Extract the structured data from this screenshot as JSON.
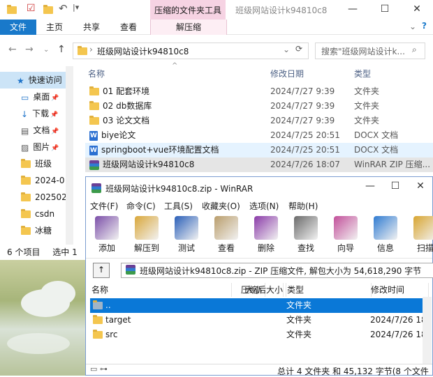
{
  "explorer": {
    "title": "班级网站设计k94810c8",
    "context_tools_label": "压缩的文件夹工具",
    "ribbon_tabs": [
      "文件",
      "主页",
      "共享",
      "查看",
      "解压缩"
    ],
    "address": "班级网站设计k94810c8",
    "search_placeholder": "搜索\"班级网站设计k...",
    "nav_items": [
      {
        "label": "快速访问",
        "icon": "star-icon",
        "pinned": false
      },
      {
        "label": "桌面",
        "icon": "desktop-icon",
        "pinned": true
      },
      {
        "label": "下载",
        "icon": "download-icon",
        "pinned": true
      },
      {
        "label": "文档",
        "icon": "document-icon",
        "pinned": true
      },
      {
        "label": "图片",
        "icon": "picture-icon",
        "pinned": true
      },
      {
        "label": "班级",
        "icon": "folder-icon",
        "pinned": false
      },
      {
        "label": "2024-0",
        "icon": "folder-icon",
        "pinned": false
      },
      {
        "label": "202502",
        "icon": "folder-icon",
        "pinned": false
      },
      {
        "label": "csdn",
        "icon": "folder-icon",
        "pinned": false
      },
      {
        "label": "冰糖",
        "icon": "folder-icon",
        "pinned": false
      }
    ],
    "columns": {
      "name": "名称",
      "date": "修改日期",
      "type": "类型"
    },
    "files": [
      {
        "name": "01 配套环境",
        "date": "2024/7/27 9:39",
        "type": "文件夹",
        "icon": "folder-icon"
      },
      {
        "name": "02 db数据库",
        "date": "2024/7/27 9:39",
        "type": "文件夹",
        "icon": "folder-icon"
      },
      {
        "name": "03 论文文档",
        "date": "2024/7/27 9:39",
        "type": "文件夹",
        "icon": "folder-icon"
      },
      {
        "name": "biye论文",
        "date": "2024/7/25 20:51",
        "type": "DOCX 文档",
        "icon": "docx-icon"
      },
      {
        "name": "springboot+vue环境配置文档",
        "date": "2024/7/25 20:51",
        "type": "DOCX 文档",
        "icon": "docx-icon"
      },
      {
        "name": "班级网站设计k94810c8",
        "date": "2024/7/26 18:07",
        "type": "WinRAR ZIP 压缩...",
        "icon": "rar-icon"
      }
    ],
    "status": {
      "count": "6 个项目",
      "selected": "选中 1 个"
    }
  },
  "winrar": {
    "title": "班级网站设计k94810c8.zip - WinRAR",
    "menu": [
      "文件(F)",
      "命令(C)",
      "工具(S)",
      "收藏夹(O)",
      "选项(N)",
      "帮助(H)"
    ],
    "tools": [
      {
        "label": "添加",
        "icon": "add-archive-icon"
      },
      {
        "label": "解压到",
        "icon": "extract-icon"
      },
      {
        "label": "测试",
        "icon": "test-icon"
      },
      {
        "label": "查看",
        "icon": "view-icon"
      },
      {
        "label": "删除",
        "icon": "delete-icon"
      },
      {
        "label": "查找",
        "icon": "find-icon"
      },
      {
        "label": "向导",
        "icon": "wizard-icon"
      },
      {
        "label": "信息",
        "icon": "info-icon"
      },
      {
        "label": "扫描",
        "icon": "scan-icon"
      }
    ],
    "path": "班级网站设计k94810c8.zip - ZIP 压缩文件, 解包大小为 54,618,290 字节",
    "columns": {
      "name": "名称",
      "size": "大小",
      "packed": "压缩后大小",
      "type": "类型",
      "modified": "修改时间"
    },
    "rows": [
      {
        "name": "..",
        "type": "文件夹",
        "modified": ""
      },
      {
        "name": "target",
        "type": "文件夹",
        "modified": "2024/7/26 18"
      },
      {
        "name": "src",
        "type": "文件夹",
        "modified": "2024/7/26 18"
      }
    ],
    "status": "总计 4 文件夹 和 45,132 字节(8 个文件"
  }
}
